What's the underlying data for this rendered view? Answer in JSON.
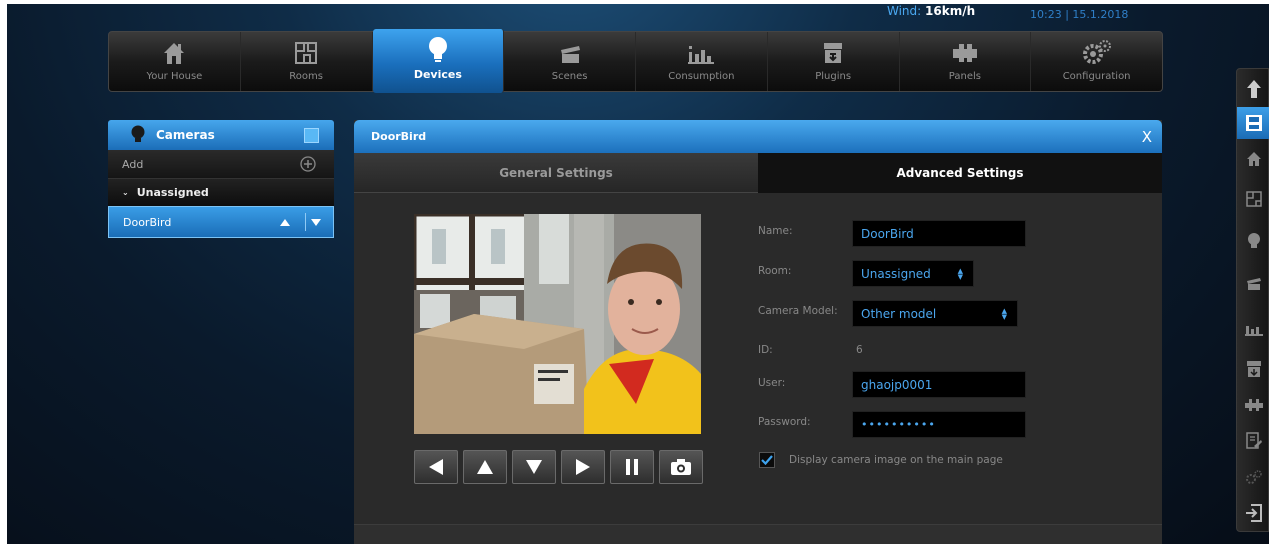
{
  "status": {
    "wind_label": "Wind:",
    "wind_value": "16km/h",
    "datetime": "10:23 | 15.1.2018"
  },
  "nav": {
    "your_house": "Your House",
    "rooms": "Rooms",
    "devices": "Devices",
    "scenes": "Scenes",
    "consumption": "Consumption",
    "plugins": "Plugins",
    "panels": "Panels",
    "configuration": "Configuration"
  },
  "sidebar": {
    "title": "Cameras",
    "add_label": "Add",
    "group_label": "Unassigned",
    "selected_item": "DoorBird"
  },
  "dialog": {
    "title": "DoorBird",
    "close": "X",
    "tabs": {
      "general": "General Settings",
      "advanced": "Advanced Settings"
    }
  },
  "form": {
    "name_label": "Name:",
    "name_value": "DoorBird",
    "room_label": "Room:",
    "room_value": "Unassigned",
    "model_label": "Camera Model:",
    "model_value": "Other model",
    "id_label": "ID:",
    "id_value": "6",
    "user_label": "User:",
    "user_value": "ghaojp0001",
    "password_label": "Password:",
    "password_value": "••••••••••",
    "display_checkbox_label": "Display camera image on the main page",
    "display_checked": true
  },
  "colors": {
    "accent": "#1f7bc7",
    "accent_light": "#46a6ec",
    "input_text": "#4ba6ee"
  }
}
